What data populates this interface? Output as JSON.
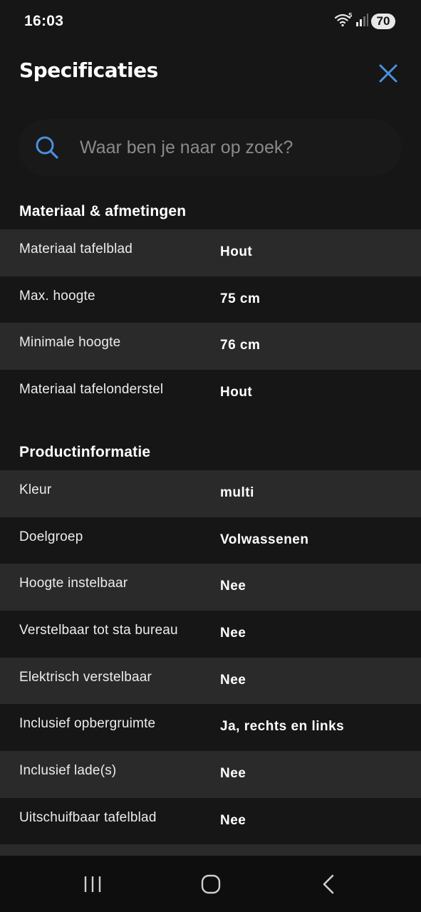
{
  "status_bar": {
    "time": "16:03",
    "battery": "70",
    "wifi_badge": "5"
  },
  "header": {
    "title": "Specificaties",
    "close_icon": "close-icon"
  },
  "search": {
    "placeholder": "Waar ben je naar op zoek?",
    "value": ""
  },
  "sections": [
    {
      "title": "Materiaal & afmetingen",
      "rows": [
        {
          "label": "Materiaal tafelblad",
          "value": "Hout"
        },
        {
          "label": "Max. hoogte",
          "value": "75 cm"
        },
        {
          "label": "Minimale hoogte",
          "value": "76 cm"
        },
        {
          "label": "Materiaal tafelonderstel",
          "value": "Hout"
        }
      ]
    },
    {
      "title": "Productinformatie",
      "rows": [
        {
          "label": "Kleur",
          "value": "multi"
        },
        {
          "label": "Doelgroep",
          "value": "Volwassenen"
        },
        {
          "label": "Hoogte instelbaar",
          "value": "Nee"
        },
        {
          "label": "Verstelbaar tot sta bureau",
          "value": "Nee"
        },
        {
          "label": "Elektrisch verstelbaar",
          "value": "Nee"
        },
        {
          "label": "Inclusief opbergruimte",
          "value": "Ja, rechts en links"
        },
        {
          "label": "Inclusief lade(s)",
          "value": "Nee"
        },
        {
          "label": "Uitschuifbaar tafelblad",
          "value": "Nee"
        }
      ]
    }
  ],
  "nav": {
    "recents_icon": "recent-apps-icon",
    "home_icon": "home-icon",
    "back_icon": "back-icon"
  },
  "colors": {
    "background": "#161616",
    "row_alt": "#2a2a2a",
    "accent": "#4a90e2"
  }
}
